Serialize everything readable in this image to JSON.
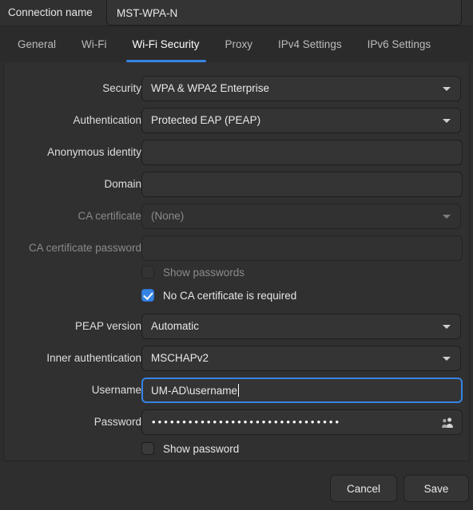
{
  "window": {
    "connection_name_label": "Connection name",
    "connection_name_value": "MST-WPA-N"
  },
  "tabs": [
    {
      "label": "General",
      "active": false
    },
    {
      "label": "Wi-Fi",
      "active": false
    },
    {
      "label": "Wi-Fi Security",
      "active": true
    },
    {
      "label": "Proxy",
      "active": false
    },
    {
      "label": "IPv4 Settings",
      "active": false
    },
    {
      "label": "IPv6 Settings",
      "active": false
    }
  ],
  "form": {
    "security": {
      "label": "Security",
      "value": "WPA & WPA2 Enterprise"
    },
    "authentication": {
      "label": "Authentication",
      "value": "Protected EAP (PEAP)"
    },
    "anonymous_identity": {
      "label": "Anonymous identity",
      "value": ""
    },
    "domain": {
      "label": "Domain",
      "value": ""
    },
    "ca_certificate": {
      "label": "CA certificate",
      "value": "(None)"
    },
    "ca_certificate_password": {
      "label": "CA certificate password",
      "value": ""
    },
    "show_passwords": {
      "label": "Show passwords",
      "checked": false
    },
    "no_ca_required": {
      "label": "No CA certificate is required",
      "checked": true
    },
    "peap_version": {
      "label": "PEAP version",
      "value": "Automatic"
    },
    "inner_authentication": {
      "label": "Inner authentication",
      "value": "MSCHAPv2"
    },
    "username": {
      "label": "Username",
      "value": "UM-AD\\username"
    },
    "password": {
      "label": "Password",
      "value": "•••••••••••••••••••••••••••••••"
    },
    "show_password": {
      "label": "Show password",
      "checked": false
    }
  },
  "footer": {
    "cancel_label": "Cancel",
    "save_label": "Save"
  },
  "colors": {
    "accent": "#3584e4",
    "background": "#2e2e2e",
    "panel": "#303030",
    "field": "#343434",
    "text": "#e8e8e7",
    "text_dim": "#8b8b8a"
  }
}
